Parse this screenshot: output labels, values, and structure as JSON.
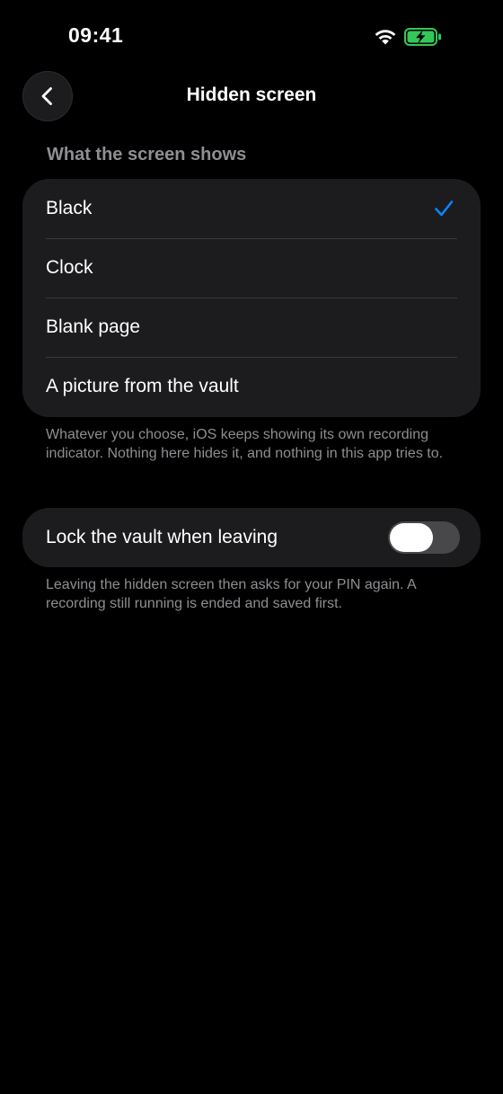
{
  "status_bar": {
    "time": "09:41",
    "wifi_icon": "wifi-icon",
    "battery_icon": "battery-charging-icon",
    "battery_color": "#34c759"
  },
  "nav": {
    "back_icon": "chevron-left-icon",
    "title": "Hidden screen"
  },
  "display_section": {
    "header": "What the screen shows",
    "options": [
      {
        "label": "Black",
        "selected": true
      },
      {
        "label": "Clock",
        "selected": false
      },
      {
        "label": "Blank page",
        "selected": false
      },
      {
        "label": "A picture from the vault",
        "selected": false
      }
    ],
    "selected_color": "#0a84ff",
    "footnote": "Whatever you choose, iOS keeps showing its own recording indicator. Nothing here hides it, and nothing in this app tries to."
  },
  "lock_section": {
    "label": "Lock the vault when leaving",
    "enabled": false,
    "footnote": "Leaving the hidden screen then asks for your PIN again. A recording still running is ended and saved first."
  }
}
